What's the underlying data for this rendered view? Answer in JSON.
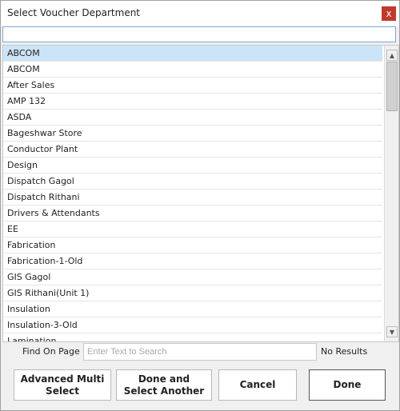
{
  "dialog": {
    "title": "Select Voucher Department",
    "close_glyph": "x"
  },
  "search": {
    "value": ""
  },
  "list": {
    "items": [
      "ABCOM",
      "ABCOM",
      "After Sales",
      "AMP 132",
      "ASDA",
      "Bageshwar Store",
      "Conductor Plant",
      "Design",
      "Dispatch Gagol",
      "Dispatch Rithani",
      "Drivers & Attendants",
      "EE",
      "Fabrication",
      "Fabrication-1-Old",
      "GIS Gagol",
      "GIS Rithani(Unit 1)",
      "Insulation",
      "Insulation-3-Old",
      "Lamination"
    ],
    "selected_index": 0
  },
  "scrollbar": {
    "up_glyph": "▲",
    "down_glyph": "▼"
  },
  "find": {
    "label": "Find On Page",
    "placeholder": "Enter Text to Search",
    "status": "No Results"
  },
  "buttons": {
    "advanced_multi_select": "Advanced Multi Select",
    "done_and_select_another": "Done and Select Another",
    "cancel": "Cancel",
    "done": "Done"
  }
}
